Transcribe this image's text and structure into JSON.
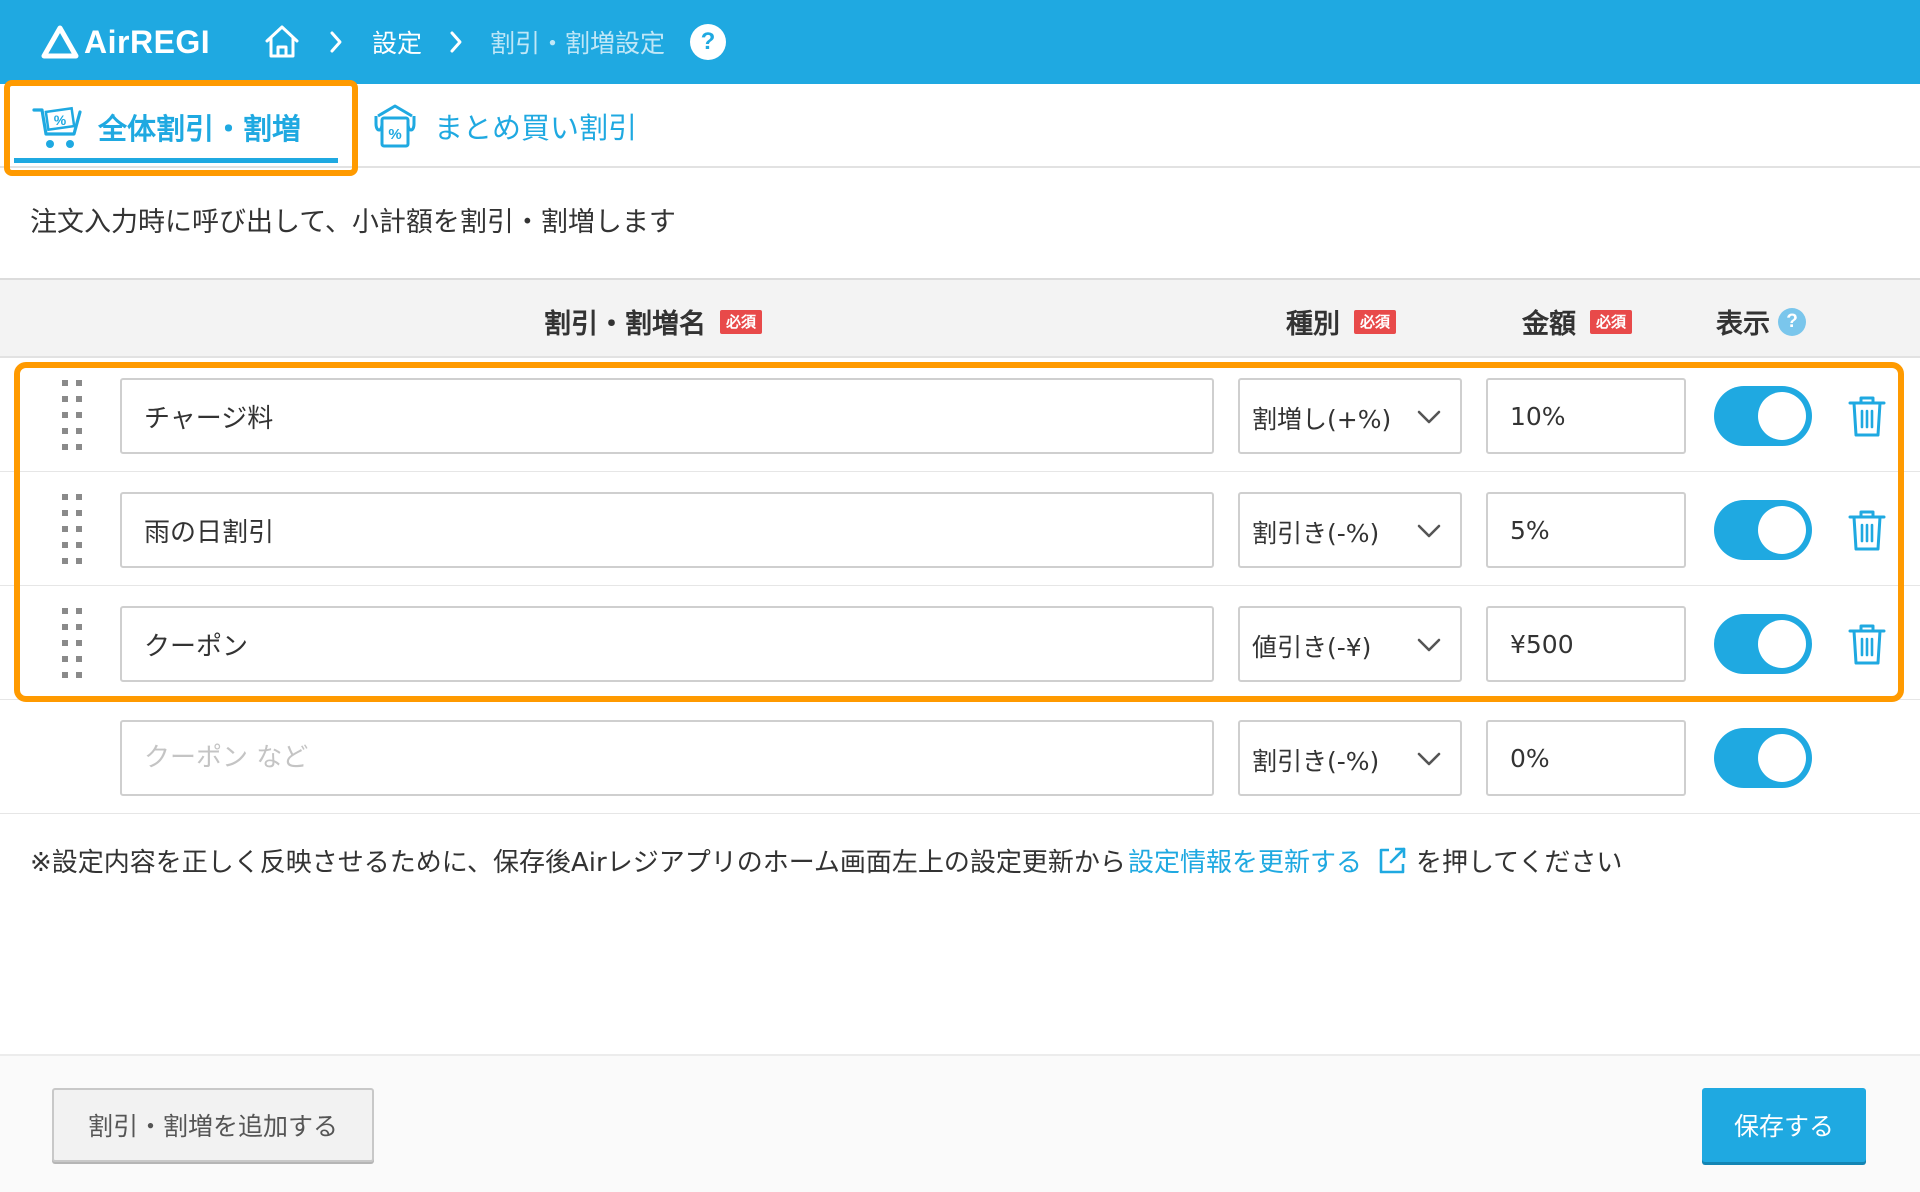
{
  "header": {
    "logo_text": "AirREGI",
    "breadcrumb": {
      "settings": "設定",
      "current": "割引・割増設定"
    },
    "help_label": "?",
    "bg_color": "#1fa9e1"
  },
  "tabs": [
    {
      "label": "全体割引・割増",
      "icon": "cart-percent-icon",
      "active": true
    },
    {
      "label": "まとめ買い割引",
      "icon": "bundle-percent-icon",
      "active": false
    }
  ],
  "description": "注文入力時に呼び出して、小計額を割引・割増します",
  "table": {
    "headers": {
      "name": "割引・割増名",
      "type": "種別",
      "amount": "金額",
      "display": "表示",
      "required_badge": "必須",
      "help": "?"
    },
    "rows": [
      {
        "name": "チャージ料",
        "type": "割増し(+%)",
        "amount": "10%",
        "display_on": true
      },
      {
        "name": "雨の日割引",
        "type": "割引き(-%)",
        "amount": "5%",
        "display_on": true
      },
      {
        "name": "クーポン",
        "type": "値引き(-¥)",
        "amount": "¥500",
        "display_on": true
      }
    ],
    "new_row": {
      "name_placeholder": "クーポン など",
      "type": "割引き(-%)",
      "amount": "0%",
      "display_on": true
    }
  },
  "note": {
    "before": "※設定内容を正しく反映させるために、保存後Airレジアプリのホーム画面左上の設定更新から",
    "link": "設定情報を更新する",
    "after": "を押してください"
  },
  "footer": {
    "add_button": "割引・割増を追加する",
    "save_button": "保存する"
  },
  "colors": {
    "accent": "#1fa9e1",
    "highlight": "#ff9a00",
    "required": "#e84a4a"
  }
}
